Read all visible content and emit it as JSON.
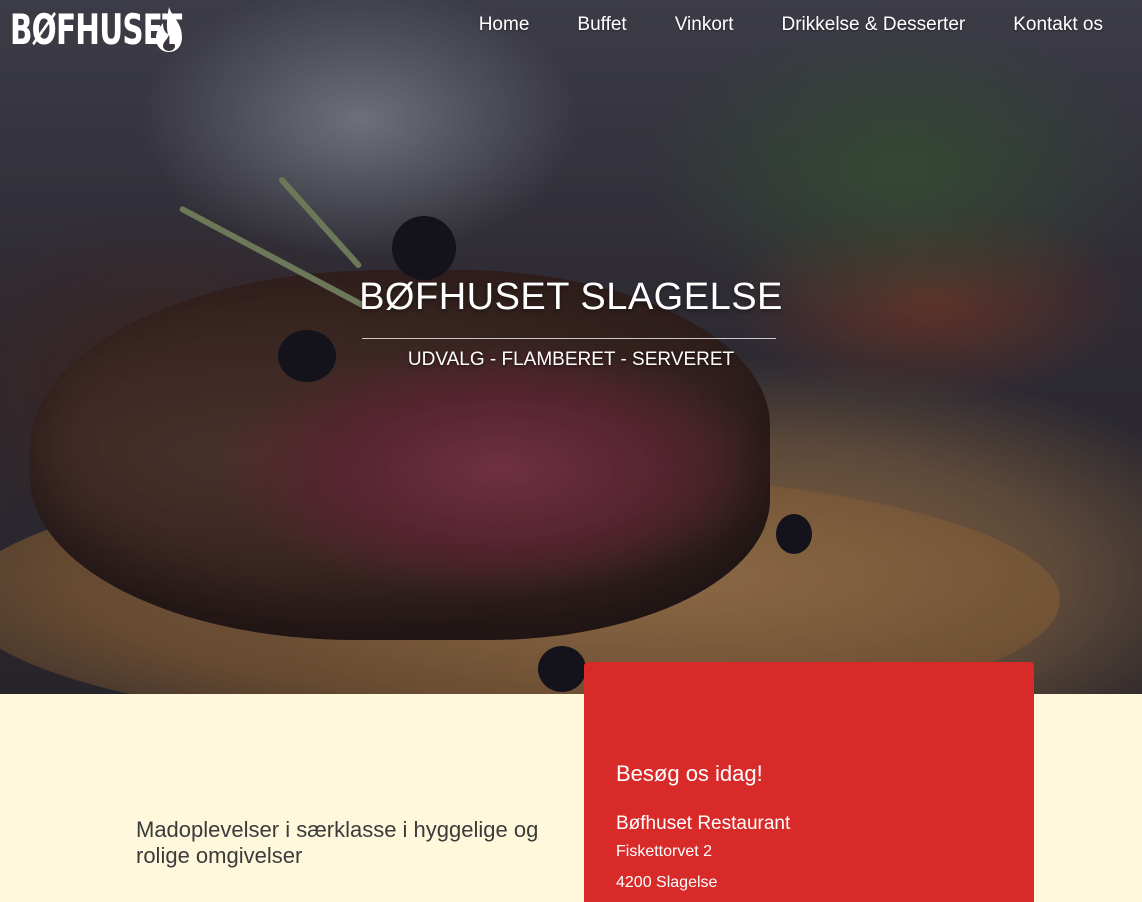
{
  "brand": {
    "logo_text": "BØFHUSET",
    "logo_icon": "flame-icon"
  },
  "nav": {
    "items": [
      {
        "label": "Home"
      },
      {
        "label": "Buffet"
      },
      {
        "label": "Vinkort"
      },
      {
        "label": "Drikkelse & Desserter"
      },
      {
        "label": "Kontakt os"
      }
    ]
  },
  "hero": {
    "title": "BØFHUSET SLAGELSE",
    "subtitle": "UDVALG - FLAMBERET - SERVERET"
  },
  "intro": {
    "tagline": "Madoplevelser i særklasse i hyggelige og rolige omgivelser"
  },
  "visit": {
    "heading": "Besøg os idag!",
    "name": "Bøfhuset Restaurant",
    "street": "Fiskettorvet 2",
    "city": "4200 Slagelse"
  },
  "colors": {
    "accent_red": "#d92a2a",
    "cream_background": "#fff8dc",
    "text_dark": "#3b3b3b"
  }
}
